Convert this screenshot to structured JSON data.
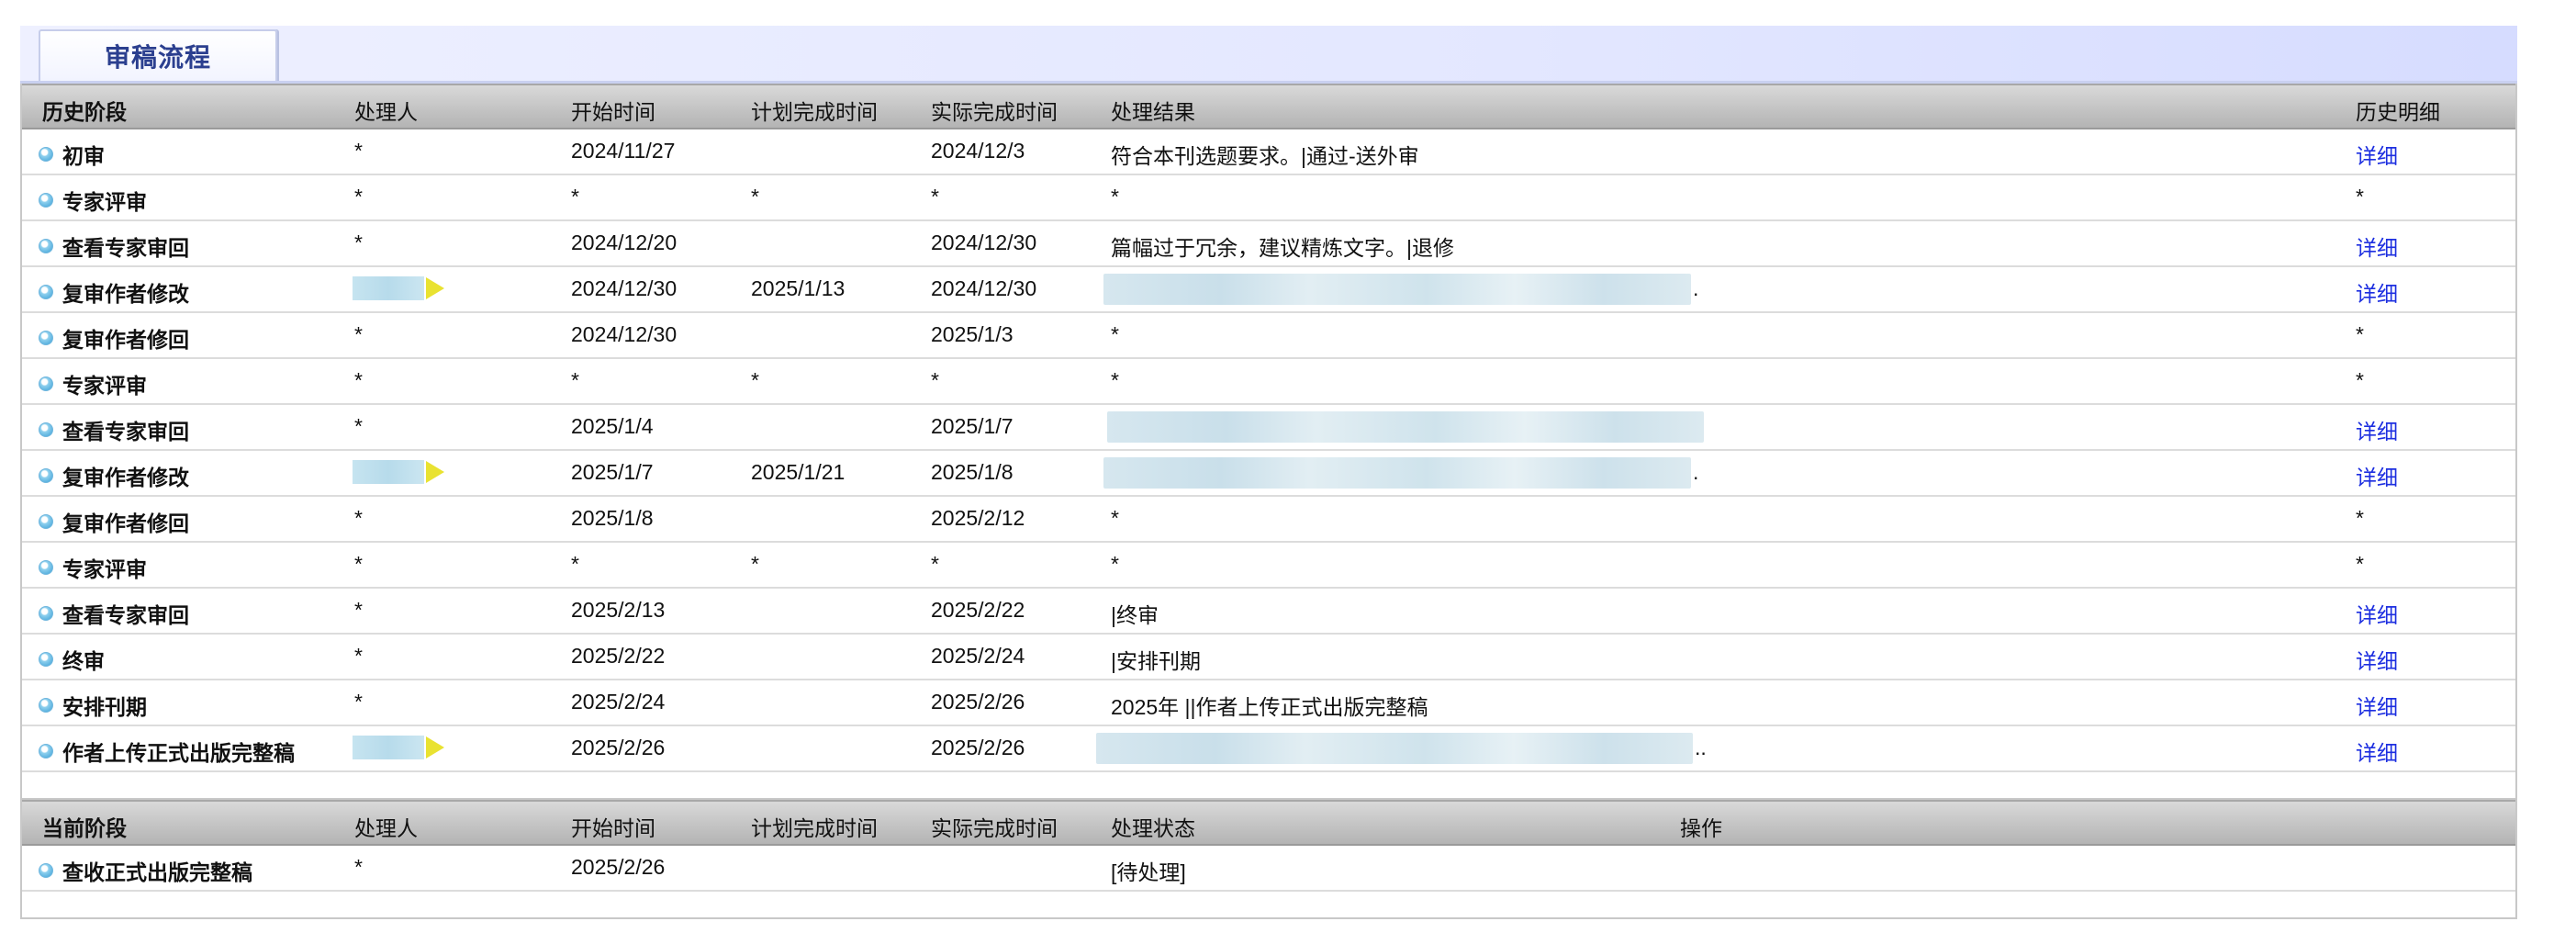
{
  "tab": {
    "label": "审稿流程"
  },
  "history": {
    "headers": {
      "stage": "历史阶段",
      "handler": "处理人",
      "start": "开始时间",
      "planned": "计划完成时间",
      "actual": "实际完成时间",
      "result": "处理结果",
      "detail": "历史明细"
    },
    "rows": [
      {
        "stage": "初审",
        "handler": "*",
        "start": "2024/11/27",
        "planned": "",
        "actual": "2024/12/3",
        "result": "符合本刊选题要求。|通过-送外审",
        "detail": "详细"
      },
      {
        "stage": "专家评审",
        "handler": "*",
        "start": "*",
        "planned": "*",
        "actual": "*",
        "result": "*",
        "detail": "*"
      },
      {
        "stage": "查看专家审回",
        "handler": "*",
        "start": "2024/12/20",
        "planned": "",
        "actual": "2024/12/30",
        "result": "篇幅过于冗余，建议精炼文字。|退修",
        "detail": "详细"
      },
      {
        "stage": "复审作者修改",
        "handler": "",
        "start": "2024/12/30",
        "planned": "2025/1/13",
        "actual": "2024/12/30",
        "result": ".",
        "detail": "详细"
      },
      {
        "stage": "复审作者修回",
        "handler": "*",
        "start": "2024/12/30",
        "planned": "",
        "actual": "2025/1/3",
        "result": "*",
        "detail": "*"
      },
      {
        "stage": "专家评审",
        "handler": "*",
        "start": "*",
        "planned": "*",
        "actual": "*",
        "result": "*",
        "detail": "*"
      },
      {
        "stage": "查看专家审回",
        "handler": "*",
        "start": "2025/1/4",
        "planned": "",
        "actual": "2025/1/7",
        "result": "",
        "detail": "详细"
      },
      {
        "stage": "复审作者修改",
        "handler": "",
        "start": "2025/1/7",
        "planned": "2025/1/21",
        "actual": "2025/1/8",
        "result": ".",
        "detail": "详细"
      },
      {
        "stage": "复审作者修回",
        "handler": "*",
        "start": "2025/1/8",
        "planned": "",
        "actual": "2025/2/12",
        "result": "*",
        "detail": "*"
      },
      {
        "stage": "专家评审",
        "handler": "*",
        "start": "*",
        "planned": "*",
        "actual": "*",
        "result": "*",
        "detail": "*"
      },
      {
        "stage": "查看专家审回",
        "handler": "*",
        "start": "2025/2/13",
        "planned": "",
        "actual": "2025/2/22",
        "result": "|终审",
        "detail": "详细"
      },
      {
        "stage": "终审",
        "handler": "*",
        "start": "2025/2/22",
        "planned": "",
        "actual": "2025/2/24",
        "result": "|安排刊期",
        "detail": "详细"
      },
      {
        "stage": "安排刊期",
        "handler": "*",
        "start": "2025/2/24",
        "planned": "",
        "actual": "2025/2/26",
        "result": "2025年 ||作者上传正式出版完整稿",
        "detail": "详细"
      },
      {
        "stage": "作者上传正式出版完整稿",
        "handler": "",
        "start": "2025/2/26",
        "planned": "",
        "actual": "2025/2/26",
        "result": "..",
        "detail": "详细"
      }
    ]
  },
  "current": {
    "headers": {
      "stage": "当前阶段",
      "handler": "处理人",
      "start": "开始时间",
      "planned": "计划完成时间",
      "actual": "实际完成时间",
      "status": "处理状态",
      "operation": "操作"
    },
    "rows": [
      {
        "stage": "查收正式出版完整稿",
        "handler": "*",
        "start": "2025/2/26",
        "planned": "",
        "actual": "",
        "status": "[待处理]",
        "operation": ""
      }
    ]
  }
}
